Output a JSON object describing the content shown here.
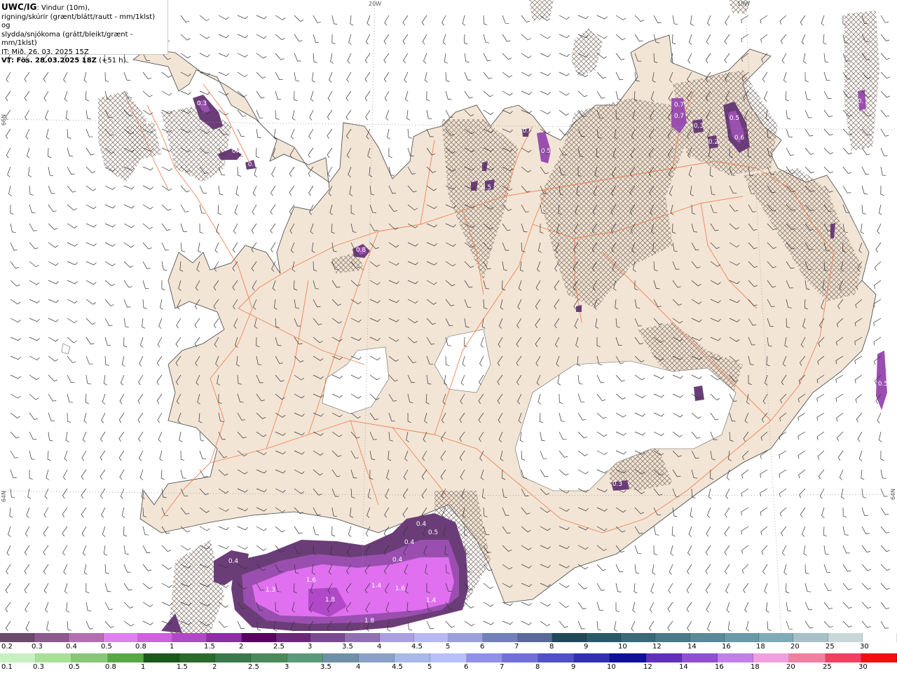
{
  "header": {
    "model": "UWC/IG",
    "line1": ": Vindur (10m),",
    "line2": "rigning/skúrir (grænt/blátt/rautt - mm/1klst) og",
    "line3": "slydda/snjókoma (grátt/bleikt/grænt - mm/1klst)",
    "init": "IT: Mið. 26. 03. 2025 15Z",
    "valid_bold": "VT: Fös. 28.03.2025 18Z",
    "valid_lead": "(+51 h)"
  },
  "grid_labels": {
    "lon_20w": "20W",
    "lon_15w": "15W",
    "lat_66n": "66N",
    "lat_64n_left": "64N",
    "lat_64n_right": "64N"
  },
  "precip_labels": [
    "0.3",
    "0.4",
    "0.",
    "0.8",
    "0.",
    "0.5",
    "0.5",
    "0.7",
    "0.7",
    "0.3",
    "0.2",
    "0.5",
    "0.6",
    "0.",
    "0.5",
    "0.3",
    "0.4",
    "0.5",
    "0.4",
    "0.4",
    "0.4",
    "1.3",
    "1.6",
    "1.8",
    "1.4",
    "1.6",
    "1.4",
    "1.8"
  ],
  "colors": {
    "land": "#f2e5d6",
    "roads": "#f07a48",
    "coast": "#444444",
    "glacier": "#ffffff",
    "hatch": "#7a6a60",
    "snow_light": "#e070f0",
    "snow_mid": "#9a4fb0",
    "snow_dark": "#6b3d78"
  },
  "legend": {
    "snow_row": {
      "labels": [
        "0.2",
        "0.3",
        "0.4",
        "0.5",
        "0.8",
        "1",
        "1.5",
        "2",
        "2.5",
        "3",
        "3.5",
        "4",
        "4.5",
        "5",
        "6",
        "7",
        "8",
        "9",
        "10",
        "12",
        "14",
        "16",
        "18",
        "20",
        "25",
        "30"
      ],
      "colors": [
        "#6b4a6b",
        "#8c5a8c",
        "#b070b0",
        "#e080f0",
        "#d060e0",
        "#b048c8",
        "#902ca8",
        "#5a0060",
        "#6a2a78",
        "#7a4a90",
        "#9070b0",
        "#aaa0e0",
        "#b8b8f0",
        "#9aa0d8",
        "#7080b8",
        "#5a6a98",
        "#204858",
        "#2a5a6a",
        "#3a6a78",
        "#4a7a88",
        "#5a8a98",
        "#6a9aa8",
        "#80aab8",
        "#a8c0c8",
        "#c8d8d8",
        "#ffffff"
      ]
    },
    "rain_row": {
      "labels": [
        "0.1",
        "0.3",
        "0.5",
        "0.8",
        "1",
        "1.5",
        "2",
        "2.5",
        "3",
        "3.5",
        "4",
        "4.5",
        "5",
        "6",
        "7",
        "8",
        "9",
        "10",
        "12",
        "14",
        "16",
        "18",
        "20",
        "25",
        "30"
      ],
      "colors": [
        "#c8f0c0",
        "#a8e098",
        "#88c878",
        "#58a848",
        "#1a5a1a",
        "#2a6a2a",
        "#3a7a4a",
        "#4a8a5a",
        "#5a9a7a",
        "#7090a8",
        "#8aa0c8",
        "#a8b8e8",
        "#b8c0f8",
        "#9090e8",
        "#7070d8",
        "#5050c8",
        "#3030b0",
        "#101098",
        "#6030b8",
        "#9050d0",
        "#c080e8",
        "#f0a0e0",
        "#f080a0",
        "#f04060",
        "#f01010"
      ]
    }
  }
}
